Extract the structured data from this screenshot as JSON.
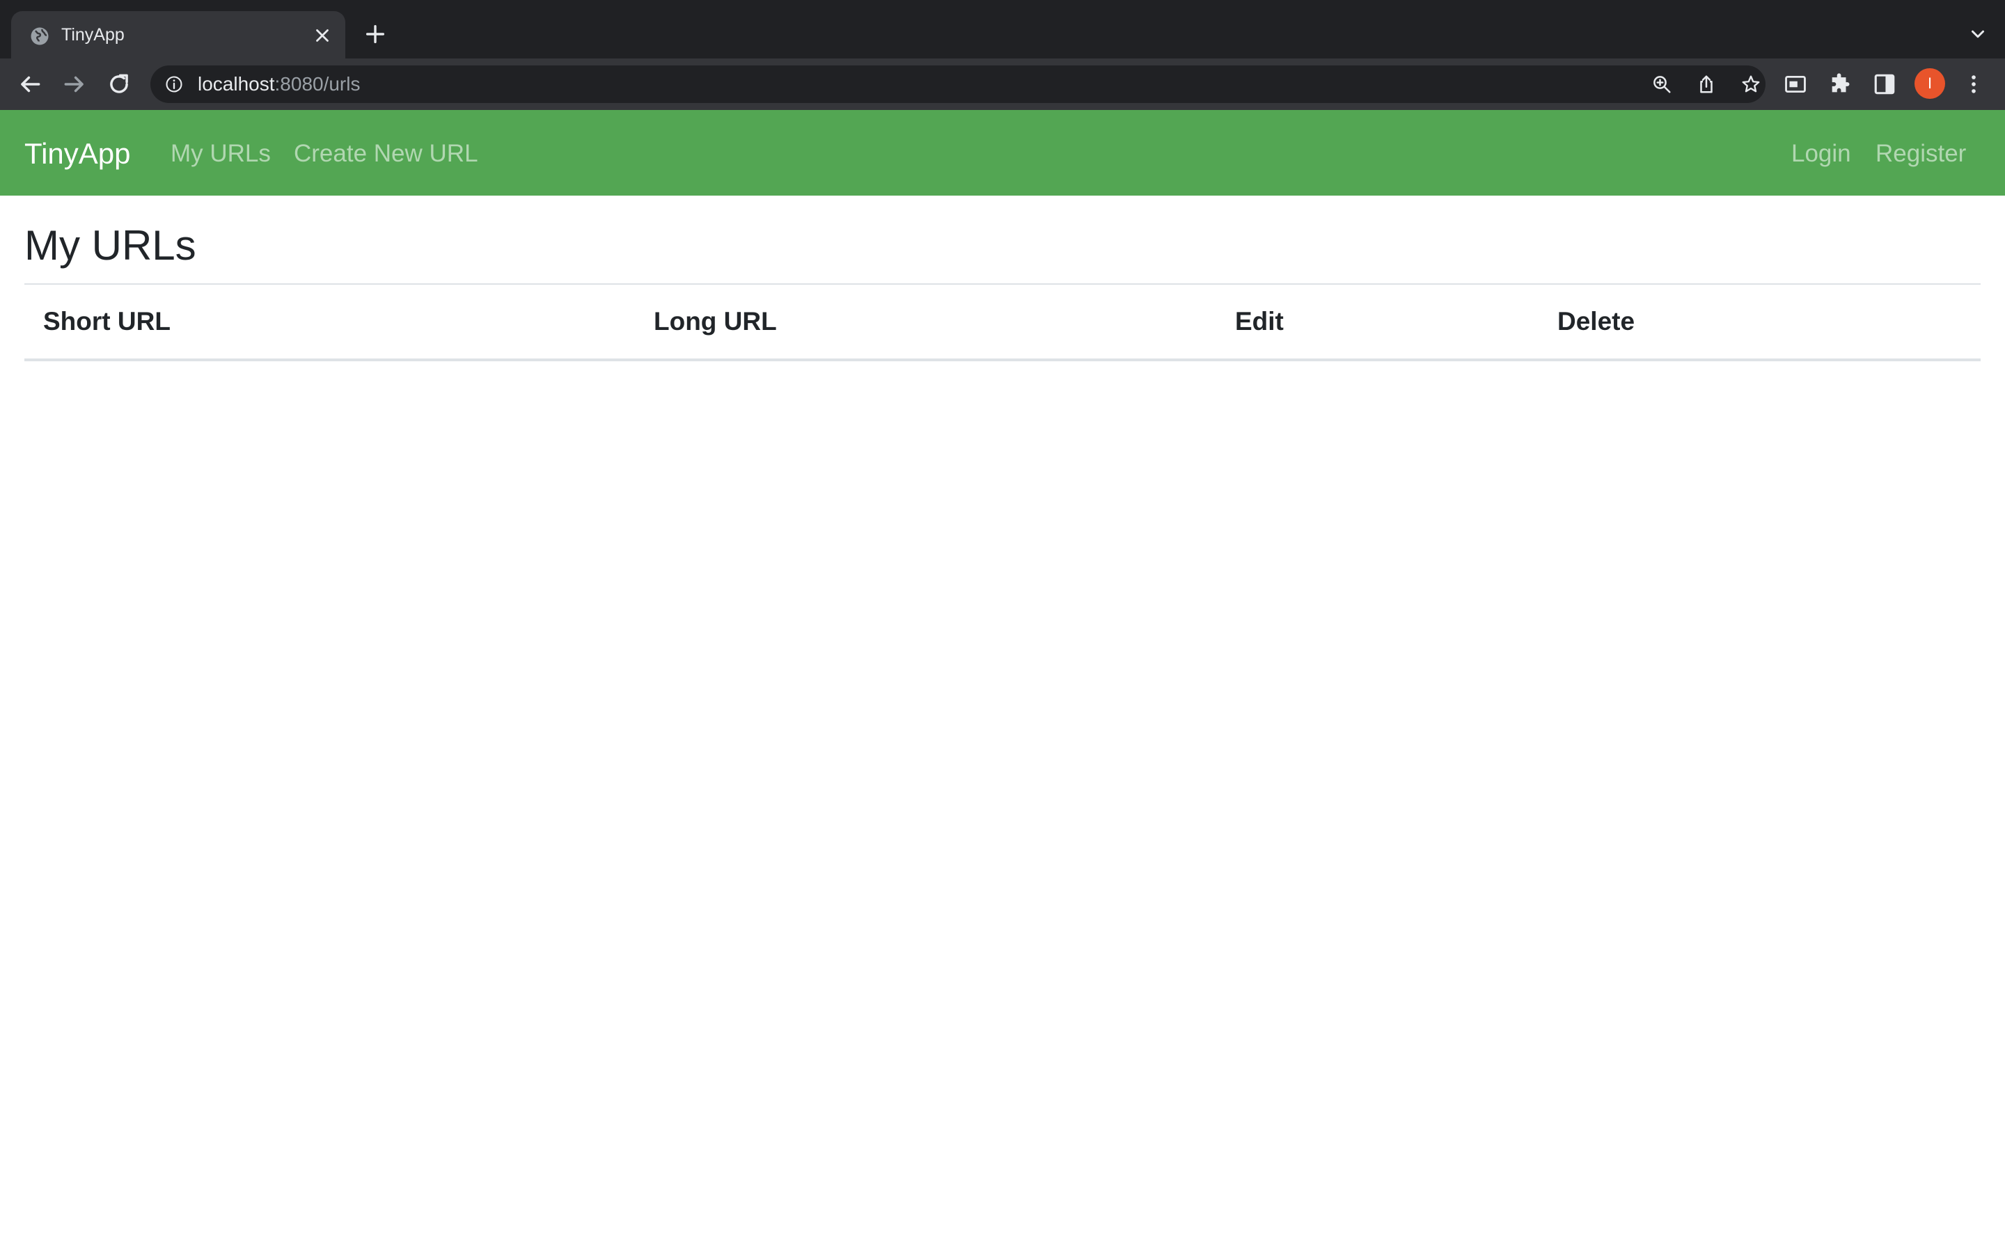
{
  "browser": {
    "tab": {
      "title": "TinyApp",
      "favicon_icon": "globe-icon",
      "close_icon": "close-icon"
    },
    "new_tab_icon": "plus-icon",
    "tab_search_icon": "chevron-down-icon",
    "address_bar": {
      "info_icon": "info-icon",
      "host": "localhost",
      "path": ":8080/urls"
    },
    "toolbar_icons": [
      "back-icon",
      "forward-icon",
      "reload-icon",
      "zoom-icon",
      "share-icon",
      "star-icon",
      "media-icon",
      "extensions-icon",
      "side-panel-icon",
      "menu-icon"
    ],
    "profile_initial": "I",
    "colors": {
      "tabstrip": "#202124",
      "toolbar": "#35363a",
      "avatar": "#e8542b"
    }
  },
  "navbar": {
    "brand": "TinyApp",
    "left_links": [
      {
        "label": "My URLs"
      },
      {
        "label": "Create New URL"
      }
    ],
    "right_links": [
      {
        "label": "Login"
      },
      {
        "label": "Register"
      }
    ],
    "background_color": "#53a653"
  },
  "main": {
    "title": "My URLs",
    "table": {
      "columns": [
        "Short URL",
        "Long URL",
        "Edit",
        "Delete"
      ],
      "rows": []
    }
  }
}
